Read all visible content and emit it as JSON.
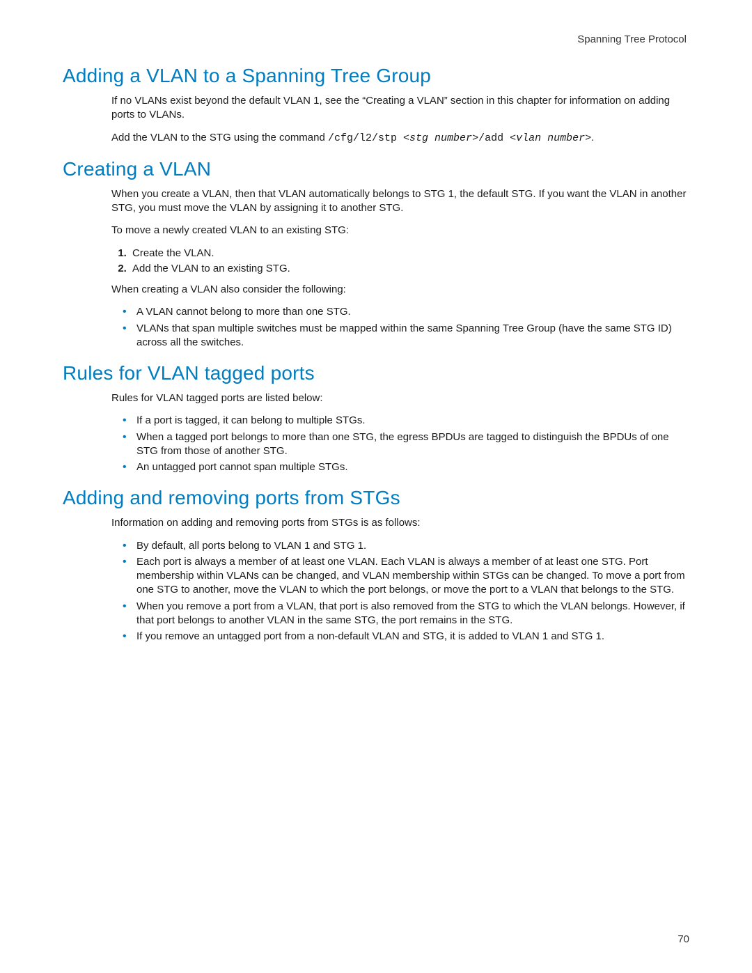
{
  "running_header": "Spanning Tree Protocol",
  "page_number": "70",
  "sections": {
    "adding_vlan_stg": {
      "title": "Adding a VLAN to a Spanning Tree Group",
      "p1": "If no VLANs exist beyond the default VLAN 1, see the “Creating a VLAN” section in this chapter for information on adding ports to VLANs.",
      "p2_prefix": "Add the VLAN to the STG using the command ",
      "p2_code1": "/cfg/l2/stp ",
      "p2_codeitalic1": "<stg number>",
      "p2_code2": "/add ",
      "p2_codeitalic2": "<vlan number>",
      "p2_suffix": "."
    },
    "creating_vlan": {
      "title": "Creating a VLAN",
      "p1": "When you create a VLAN, then that VLAN automatically belongs to STG 1, the default STG. If you want the VLAN in another STG, you must move the VLAN by assigning it to another STG.",
      "p2": "To move a newly created VLAN to an existing STG:",
      "steps": {
        "s1": "Create the VLAN.",
        "s2": "Add the VLAN to an existing STG."
      },
      "p3": "When creating a VLAN also consider the following:",
      "bullets": {
        "b1": "A VLAN cannot belong to more than one STG.",
        "b2": "VLANs that span multiple switches must be mapped within the same Spanning Tree Group (have the same STG ID) across all the switches."
      }
    },
    "rules_tagged": {
      "title": "Rules for VLAN tagged ports",
      "p1": "Rules for VLAN tagged ports are listed below:",
      "bullets": {
        "b1": "If a port is tagged, it can belong to multiple STGs.",
        "b2": "When a tagged port belongs to more than one STG, the egress BPDUs are tagged to distinguish the BPDUs of one STG from those of another STG.",
        "b3": "An untagged port cannot span multiple STGs."
      }
    },
    "add_remove_ports": {
      "title": "Adding and removing ports from STGs",
      "p1": "Information on adding and removing ports from STGs is as follows:",
      "bullets": {
        "b1": "By default, all ports belong to VLAN 1 and STG 1.",
        "b2": "Each port is always a member of at least one VLAN. Each VLAN is always a member of at least one STG. Port membership within VLANs can be changed, and VLAN membership within STGs can be changed. To move a port from one STG to another, move the VLAN to which the port belongs, or move the port to a VLAN that belongs to the STG.",
        "b3": "When you remove a port from a VLAN, that port is also removed from the STG to which the VLAN belongs. However, if that port belongs to another VLAN in the same STG, the port remains in the STG.",
        "b4": "If you remove an untagged port from a non-default VLAN and STG, it is added to VLAN 1 and STG 1."
      }
    }
  }
}
